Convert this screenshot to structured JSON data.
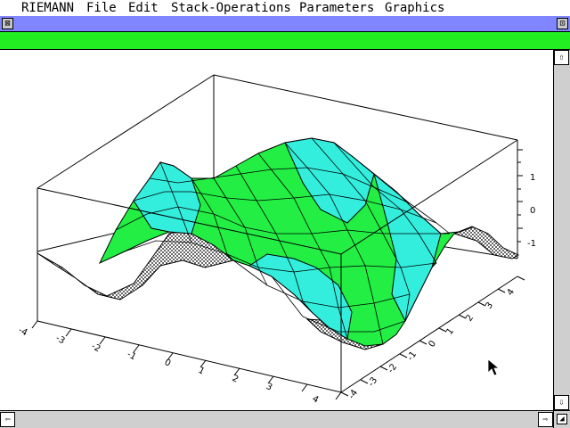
{
  "menubar": {
    "items": [
      "RIEMANN",
      "File",
      "Edit",
      "Stack-Operations",
      "Parameters",
      "Graphics"
    ]
  },
  "window": {
    "close_glyph": "⊠",
    "zoom_glyph": "⊡",
    "title_color": "#7f86ff",
    "info_color": "#22ee22"
  },
  "plot": {
    "type": "surface3d",
    "z_ticks": [
      "1",
      "0",
      "-1"
    ],
    "x_ticks": [
      "-4",
      "-3",
      "-2",
      "-1",
      "0",
      "1",
      "2",
      "3",
      "4"
    ],
    "y_ticks": [
      "-4",
      "-3",
      "-2",
      "-1",
      "0",
      "1",
      "2",
      "3",
      "4"
    ],
    "surface_colors": {
      "top": "#22ee44",
      "side": "#33eedd"
    }
  },
  "scrollbars": {
    "up_glyph": "⇧",
    "down_glyph": "⇩",
    "left_glyph": "⇦",
    "right_glyph": "⇨",
    "grow_glyph": "◢"
  }
}
